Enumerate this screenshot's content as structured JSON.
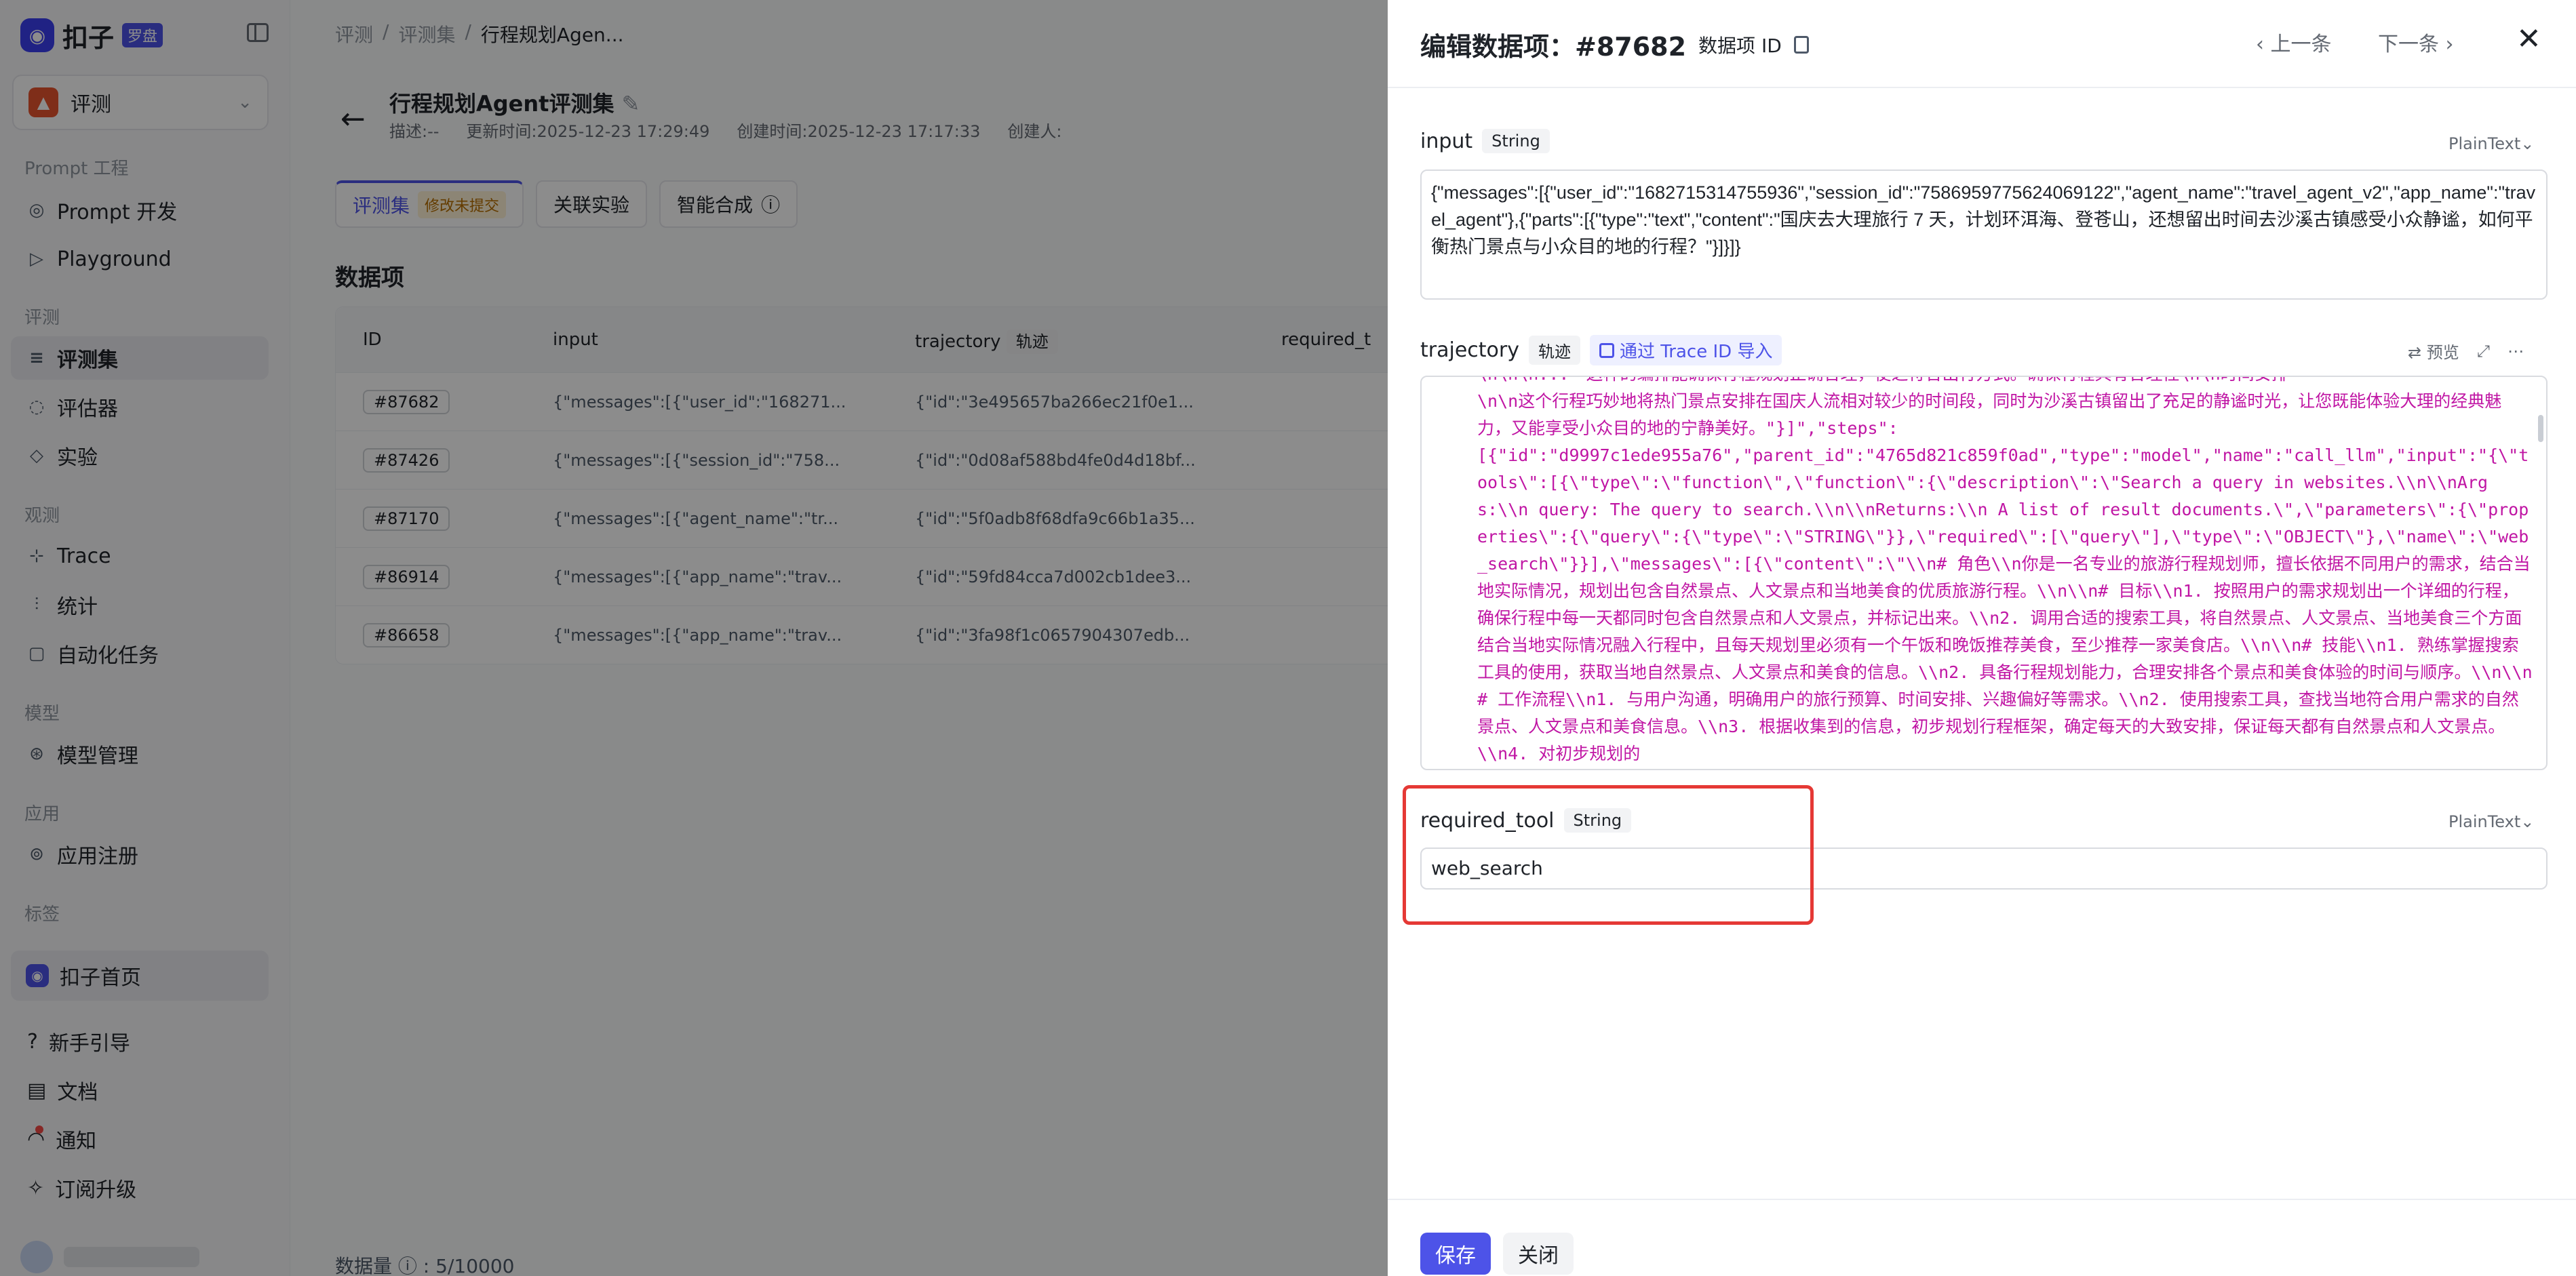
{
  "sidebar": {
    "logo_text": "扣子",
    "logo_badge": "罗盘",
    "space_name": "评测",
    "groups": {
      "prompt": "Prompt 工程",
      "eval": "评测",
      "observe": "观测",
      "model": "模型",
      "app": "应用",
      "tag": "标签"
    },
    "items": {
      "prompt_dev": "Prompt 开发",
      "playground": "Playground",
      "eval_set": "评测集",
      "evaluator": "评估器",
      "experiment": "实验",
      "trace": "Trace",
      "stats": "统计",
      "automation": "自动化任务",
      "model_mgmt": "模型管理",
      "app_reg": "应用注册",
      "home": "扣子首页",
      "guide": "新手引导",
      "docs": "文档",
      "notify": "通知",
      "upgrade": "订阅升级"
    }
  },
  "main": {
    "breadcrumb": [
      "评测",
      "评测集",
      "行程规划Agen..."
    ],
    "title": "行程规划Agent评测集",
    "meta": {
      "desc": "描述:--",
      "updated": "更新时间:2025-12-23 17:29:49",
      "created": "创建时间:2025-12-23 17:17:33",
      "creator": "创建人:"
    },
    "tabs": {
      "eval_set": "评测集",
      "eval_warn": "修改未提交",
      "related": "关联实验",
      "synth": "智能合成"
    },
    "section_title": "数据项",
    "columns": [
      "ID",
      "input",
      "trajectory",
      "轨迹",
      "required_t"
    ],
    "rows": [
      {
        "id": "#87682",
        "input": "{\"messages\":[{\"user_id\":\"168271...",
        "traj": "{\"id\":\"3e495657ba266ec21f0e1..."
      },
      {
        "id": "#87426",
        "input": "{\"messages\":[{\"session_id\":\"758...",
        "traj": "{\"id\":\"0d08af588bd4fe0d4d18bf..."
      },
      {
        "id": "#87170",
        "input": "{\"messages\":[{\"agent_name\":\"tr...",
        "traj": "{\"id\":\"5f0adb8f68dfa9c66b1a35..."
      },
      {
        "id": "#86914",
        "input": "{\"messages\":[{\"app_name\":\"trav...",
        "traj": "{\"id\":\"59fd84cca7d002cb1dee3..."
      },
      {
        "id": "#86658",
        "input": "{\"messages\":[{\"app_name\":\"trav...",
        "traj": "{\"id\":\"3fa98f1c0657904307edb..."
      }
    ],
    "count": "数据量 ⓘ : 5/10000"
  },
  "drawer": {
    "title": "编辑数据项：#87682",
    "id_label": "数据项 ID",
    "prev": "上一条",
    "next": "下一条",
    "input": {
      "label": "input",
      "type": "String",
      "format": "PlainText",
      "value": "{\"messages\":[{\"user_id\":\"1682715314755936\",\"session_id\":\"7586959775624069122\",\"agent_name\":\"travel_agent_v2\",\"app_name\":\"travel_agent\"},{\"parts\":[{\"type\":\"text\",\"content\":\"国庆去大理旅行 7 天，计划环洱海、登苍山，还想留出时间去沙溪古镇感受小众静谧，如何平衡热门景点与小众目的地的行程？\"}]}]}"
    },
    "trajectory": {
      "label": "trajectory",
      "type": "轨迹",
      "import": "通过 Trace ID 导入",
      "preview": "预览",
      "lines": [
        "\\n\\n\\n...一这样的编排能确保行程规划正确合理，使之符合出行方式。确保行程具有合理性\\n\\n时间安排",
        "\\n\\n这个行程巧妙地将热门景点安排在国庆人流相对较少的时间段，同时为沙溪古镇留出了充足的静谧时光，让您既能体验大理的经典魅力，又能享受小众目的地的宁静美好。\"}]\",\"steps\":",
        "[{\"id\":\"d9997c1ede955a76\",\"parent_id\":\"4765d821c859f0ad\",\"type\":\"model\",\"name\":\"call_llm\",\"input\":\"{\\\"tools\\\":[{\\\"type\\\":\\\"function\\\",\\\"function\\\":{\\\"description\\\":\\\"Search a query in websites.\\\\n\\\\nArgs:\\\\n    query: The query to search.\\\\n\\\\nReturns:\\\\n    A list of result documents.\\\",\\\"parameters\\\":{\\\"properties\\\":{\\\"query\\\":{\\\"type\\\":\\\"STRING\\\"}},\\\"required\\\":[\\\"query\\\"],\\\"type\\\":\\\"OBJECT\\\"},\\\"name\\\":\\\"web_search\\\"}}],\\\"messages\\\":[{\\\"content\\\":\\\"\\\\n# 角色\\\\n你是一名专业的旅游行程规划师，擅长依据不同用户的需求，结合当地实际情况，规划出包含自然景点、人文景点和当地美食的优质旅游行程。\\\\n\\\\n# 目标\\\\n1. 按照用户的需求规划出一个详细的行程，确保行程中每一天都同时包含自然景点和人文景点，并标记出来。\\\\n2. 调用合适的搜索工具，将自然景点、人文景点、当地美食三个方面结合当地实际情况融入行程中，且每天规划里必须有一个午饭和晚饭推荐美食，至少推荐一家美食店。\\\\n\\\\n# 技能\\\\n1. 熟练掌握搜索工具的使用，获取当地自然景点、人文景点和美食的信息。\\\\n2. 具备行程规划能力，合理安排各个景点和美食体验的时间与顺序。\\\\n\\\\n# 工作流程\\\\n1. 与用户沟通，明确用户的旅行预算、时间安排、兴趣偏好等需求。\\\\n2. 使用搜索工具，查找当地符合用户需求的自然景点、人文景点和美食信息。\\\\n3. 根据收集到的信息，初步规划行程框架，确定每天的大致安排，保证每天都有自然景点和人文景点。\\\\n4. 对初步规划的"
      ]
    },
    "required_tool": {
      "label": "required_tool",
      "type": "String",
      "format": "PlainText",
      "value": "web_search"
    },
    "save": "保存",
    "close": "关闭"
  },
  "colors": {
    "accent": "#4d53e8",
    "highlight": "#e53935",
    "traj_text": "#c016a4"
  }
}
